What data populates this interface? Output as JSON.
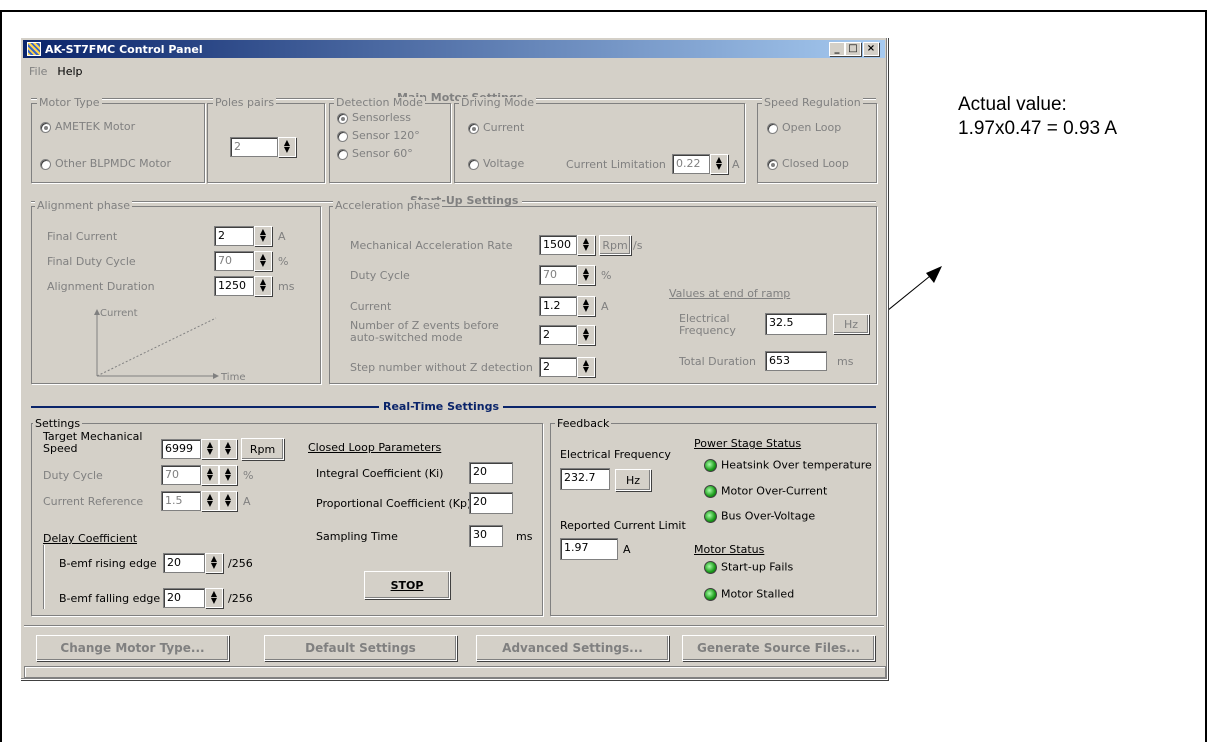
{
  "annotation": {
    "line1": "Actual value:",
    "line2": "1.97x0.47 = 0.93 A"
  },
  "window": {
    "title": "AK-ST7FMC Control Panel",
    "min": "_",
    "max": "□",
    "close": "×"
  },
  "menu": {
    "file": "File",
    "help": "Help"
  },
  "main": {
    "title": "Main Motor Settings",
    "motor_type": {
      "legend": "Motor Type",
      "opt1": "AMETEK Motor",
      "opt2": "Other BLPMDC Motor"
    },
    "poles": {
      "legend": "Poles pairs",
      "value": "2"
    },
    "detection": {
      "legend": "Detection Mode",
      "opt1": "Sensorless",
      "opt2": "Sensor 120°",
      "opt3": "Sensor 60°"
    },
    "driving": {
      "legend": "Driving Mode",
      "opt1": "Current",
      "opt2": "Voltage",
      "limit_label": "Current Limitation",
      "limit_value": "0.22",
      "limit_unit": "A"
    },
    "speed": {
      "legend": "Speed Regulation",
      "opt1": "Open Loop",
      "opt2": "Closed Loop"
    }
  },
  "startup": {
    "title": "Start-Up Settings",
    "align": {
      "legend": "Alignment phase",
      "final_current": "Final Current",
      "final_current_v": "2",
      "unit_a": "A",
      "duty": "Final Duty Cycle",
      "duty_v": "70",
      "unit_pct": "%",
      "duration": "Alignment Duration",
      "duration_v": "1250",
      "unit_ms": "ms",
      "graph_y": "Current",
      "graph_x": "Time"
    },
    "accel": {
      "legend": "Acceleration phase",
      "rate": "Mechanical Acceleration Rate",
      "rate_v": "1500",
      "rate_unit": "Rpm",
      "rate_per": "/s",
      "duty": "Duty Cycle",
      "duty_v": "70",
      "pct": "%",
      "current": "Current",
      "current_v": "1.2",
      "a": "A",
      "zevents": "Number of Z events before auto-switched mode",
      "zevents_v": "2",
      "steps": "Step number without Z detection",
      "steps_v": "2",
      "end": {
        "title": "Values at end of ramp",
        "freq": "Electrical Frequency",
        "freq_v": "32.5",
        "hz": "Hz",
        "total": "Total Duration",
        "total_v": "653",
        "ms": "ms"
      }
    }
  },
  "realtime": {
    "title": "Real-Time Settings",
    "settings": {
      "legend": "Settings",
      "target": "Target Mechanical Speed",
      "target_v": "6999",
      "rpm": "Rpm",
      "duty": "Duty Cycle",
      "duty_v": "70",
      "pct": "%",
      "curref": "Current Reference",
      "curref_v": "1.5",
      "a": "A",
      "delay": "Delay Coefficient",
      "rising": "B-emf rising edge",
      "rising_v": "20",
      "falling": "B-emf falling edge",
      "falling_v": "20",
      "div": "/256",
      "cl": "Closed Loop Parameters",
      "ki": "Integral Coefficient (Ki)",
      "ki_v": "20",
      "kp": "Proportional Coefficient (Kp)",
      "kp_v": "20",
      "samp": "Sampling Time",
      "samp_v": "30",
      "ms": "ms",
      "stop": "STOP"
    },
    "feedback": {
      "legend": "Feedback",
      "ef": "Electrical Frequency",
      "ef_v": "232.7",
      "hz": "Hz",
      "rcl": "Reported Current Limit",
      "rcl_v": "1.97",
      "a": "A",
      "pss": "Power Stage Status",
      "heatsink": "Heatsink Over temperature",
      "overcur": "Motor Over-Current",
      "overvolt": "Bus Over-Voltage",
      "ms": "Motor Status",
      "startfail": "Start-up Fails",
      "stalled": "Motor Stalled"
    }
  },
  "buttons": {
    "change": "Change Motor Type...",
    "default": "Default Settings",
    "advanced": "Advanced Settings...",
    "generate": "Generate Source Files..."
  }
}
